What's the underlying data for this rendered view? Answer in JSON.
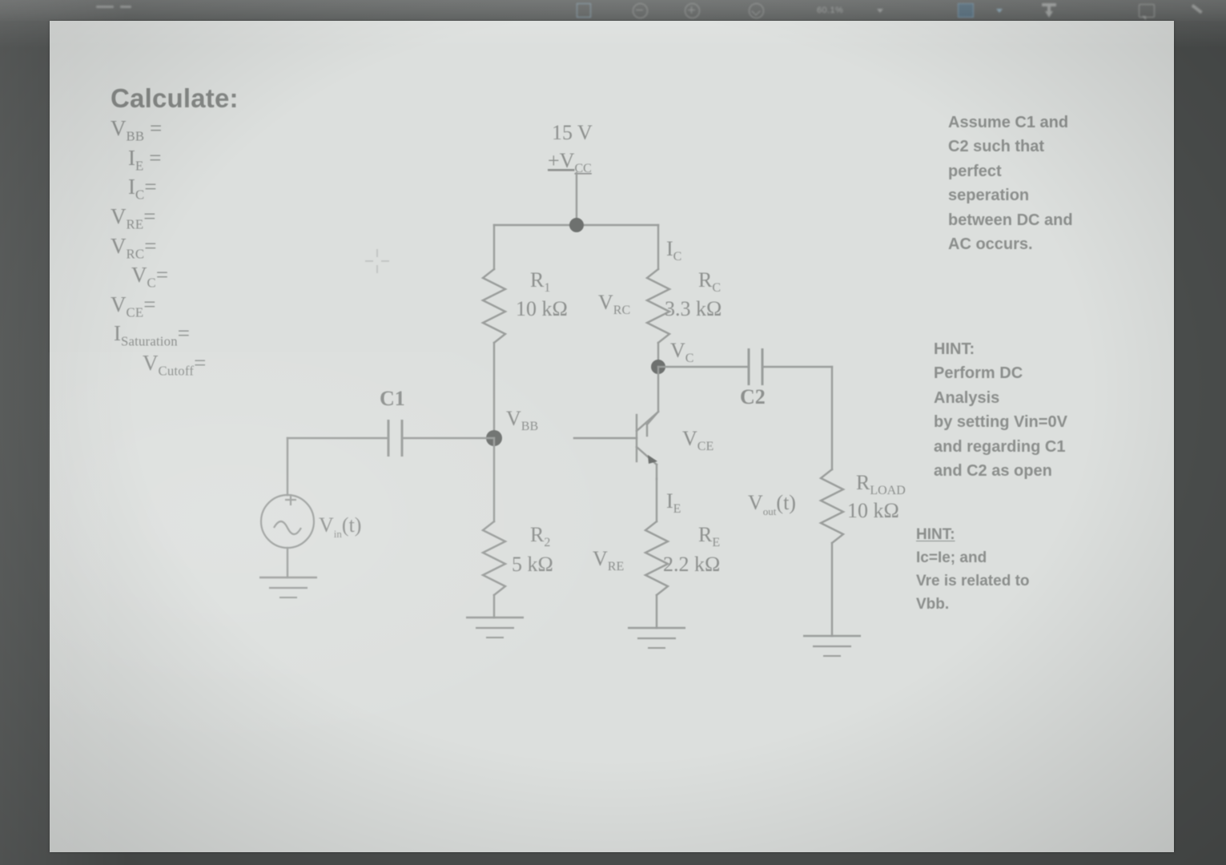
{
  "viewer": {
    "zoom_level": "60.1%",
    "tools": [
      {
        "name": "zoom-out-icon",
        "label": ""
      },
      {
        "name": "zoom-in-icon",
        "label": ""
      },
      {
        "name": "fit-page-icon",
        "label": ""
      },
      {
        "name": "select-tool-icon",
        "label": ""
      },
      {
        "name": "download-icon",
        "label": ""
      },
      {
        "name": "comment-icon",
        "label": ""
      },
      {
        "name": "highlighter-icon",
        "label": ""
      }
    ]
  },
  "document": {
    "calculate": {
      "title": "Calculate:",
      "items": [
        {
          "symbol": "V",
          "sub": "BB",
          "eq": "=",
          "indent": 0
        },
        {
          "symbol": "I",
          "sub": "E",
          "eq": "=",
          "indent": 1
        },
        {
          "symbol": "I",
          "sub": "C",
          "eq": "=",
          "indent": 1
        },
        {
          "symbol": "V",
          "sub": "RE",
          "eq": "=",
          "indent": 0
        },
        {
          "symbol": "V",
          "sub": "RC",
          "eq": "=",
          "indent": 0
        },
        {
          "symbol": "V",
          "sub": "C",
          "eq": "=",
          "indent": 2
        },
        {
          "symbol": "V",
          "sub": "CE",
          "eq": "=",
          "indent": 0
        },
        {
          "symbol": "I",
          "sub": "Saturation",
          "eq": "=",
          "indent": 3
        },
        {
          "symbol": "V",
          "sub": "Cutoff",
          "eq": "=",
          "indent": 4
        }
      ]
    },
    "notes": {
      "assume": [
        "Assume C1 and",
        "C2 such that",
        "perfect",
        "seperation",
        "between DC and",
        "AC occurs."
      ],
      "hint1_title": "HINT:",
      "hint1": [
        "Perform DC",
        "Analysis",
        "by setting Vin=0V",
        "and regarding C1",
        "and C2 as open"
      ],
      "hint2_title": "HINT:",
      "hint2": [
        "Ic=Ie; and",
        "Vre is related to",
        "Vbb."
      ]
    },
    "circuit": {
      "supply_value": "15 V",
      "supply_label": "+V",
      "supply_label_sub": "CC",
      "r1": {
        "name": "R",
        "sub": "1",
        "value": "10 kΩ"
      },
      "r2": {
        "name": "R",
        "sub": "2",
        "value": "5 kΩ"
      },
      "rc": {
        "name": "R",
        "sub": "C",
        "value": "3.3 kΩ"
      },
      "re": {
        "name": "R",
        "sub": "E",
        "value": "2.2 kΩ"
      },
      "rload": {
        "name": "R",
        "sub": "LOAD",
        "value": "10 kΩ"
      },
      "c1": "C1",
      "c2": "C2",
      "v_in": {
        "name": "V",
        "sub": "in",
        "suffix": "(t)"
      },
      "v_out": {
        "name": "V",
        "sub": "out",
        "suffix": "(t)"
      },
      "node_vbb": {
        "name": "V",
        "sub": "BB"
      },
      "node_vc": {
        "name": "V",
        "sub": "C"
      },
      "v_ce": {
        "name": "V",
        "sub": "CE"
      },
      "v_rc": {
        "name": "V",
        "sub": "RC"
      },
      "v_re": {
        "name": "V",
        "sub": "RE"
      },
      "i_c": {
        "name": "I",
        "sub": "C"
      },
      "i_e": {
        "name": "I",
        "sub": "E"
      },
      "ground_count": 4,
      "device": "npn-bjt"
    }
  },
  "colors": {
    "page_background": "#dcdfdd",
    "app_background": "#4c4f4e",
    "ink": "#8e918f",
    "wire": "#9a9d9b",
    "node": "#6e716f",
    "accent_blue": "#7fbce6"
  }
}
